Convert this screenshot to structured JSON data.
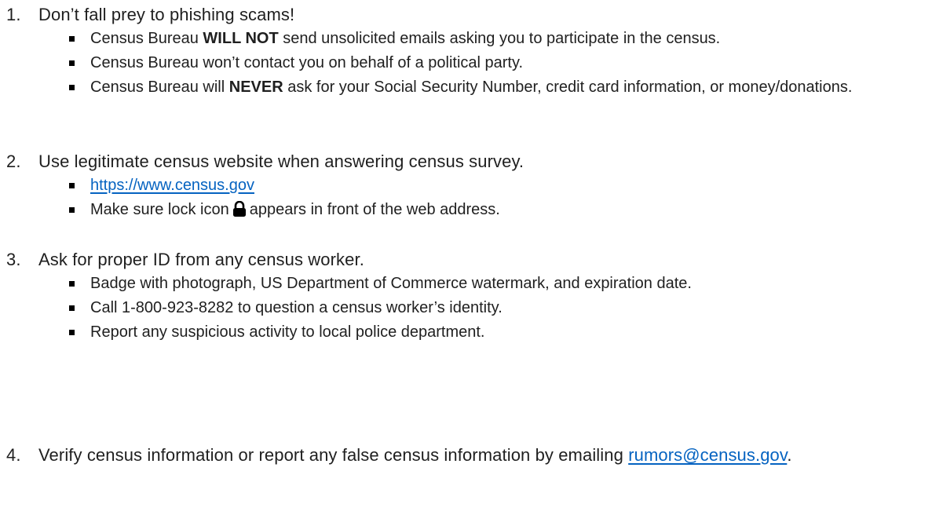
{
  "items": [
    {
      "number": "1.",
      "heading": "Don’t fall prey to phishing scams!",
      "bullets": {
        "b1": {
          "before": "Census Bureau ",
          "bold": "WILL NOT",
          "after": " send unsolicited emails asking you to participate in the census."
        },
        "b2": {
          "text": "Census Bureau won’t contact you on behalf of a political party."
        },
        "b3": {
          "before": "Census Bureau will ",
          "bold": "NEVER",
          "after": " ask for your Social Security Number, credit card information, or money/donations."
        }
      }
    },
    {
      "number": "2.",
      "heading": "Use legitimate census website when answering census survey.",
      "bullets": {
        "b1": {
          "link": "https://www.census.gov"
        },
        "b2": {
          "before": "Make sure lock icon",
          "icon": "lock-icon",
          "after": "appears in front of the web address."
        }
      }
    },
    {
      "number": "3.",
      "heading": "Ask for proper ID from any census worker.",
      "bullets": {
        "b1": {
          "text": "Badge with photograph, US Department of Commerce watermark, and expiration date."
        },
        "b2": {
          "text": "Call 1-800-923-8282 to question a census worker’s identity."
        },
        "b3": {
          "text": "Report any suspicious activity to local police department."
        }
      }
    },
    {
      "number": "4.",
      "heading_before": "Verify census information or report any false census information by emailing",
      "heading_link": "rumors@census.gov",
      "heading_after": "."
    }
  ],
  "colors": {
    "text": "#1f1f1f",
    "link": "#0563c1",
    "bullet": "#000000"
  }
}
